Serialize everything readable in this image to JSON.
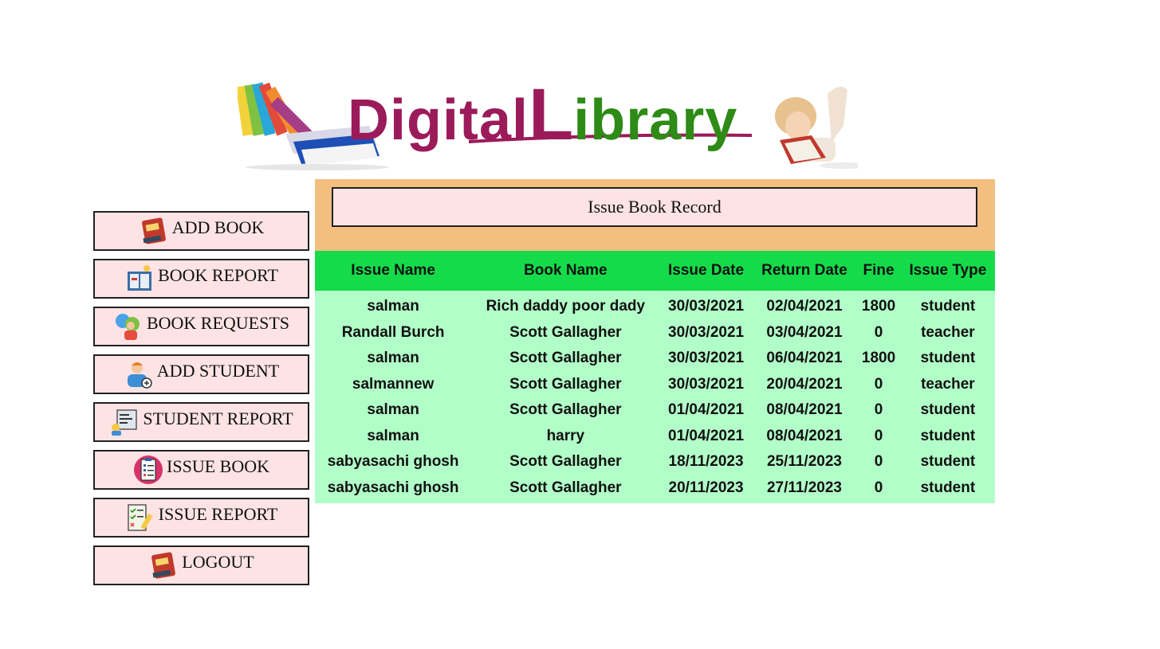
{
  "banner": {
    "logo_part1": "Digital",
    "logo_part2": "L",
    "logo_part3": "ibrary",
    "colors": {
      "primary": "#9b1b5a",
      "secondary": "#2e8b16"
    }
  },
  "sidebar": {
    "items": [
      {
        "label": "ADD BOOK",
        "icon": "book-icon"
      },
      {
        "label": "BOOK REPORT",
        "icon": "book-report-icon"
      },
      {
        "label": "BOOK REQUESTS",
        "icon": "users-icon"
      },
      {
        "label": "ADD STUDENT",
        "icon": "add-user-icon"
      },
      {
        "label": "STUDENT REPORT",
        "icon": "student-report-icon"
      },
      {
        "label": "ISSUE BOOK",
        "icon": "clipboard-icon"
      },
      {
        "label": "ISSUE REPORT",
        "icon": "checklist-icon"
      },
      {
        "label": "LOGOUT",
        "icon": "book-icon"
      }
    ]
  },
  "main": {
    "title": "Issue Book Record",
    "colors": {
      "header_bg": "#15db4b",
      "body_bg": "#b2fec8",
      "title_bg": "#f3bf81",
      "button_bg": "#fde3e4"
    },
    "columns": [
      "Issue Name",
      "Book Name",
      "Issue Date",
      "Return Date",
      "Fine",
      "Issue Type"
    ],
    "rows": [
      [
        "salman",
        "Rich daddy poor dady",
        "30/03/2021",
        "02/04/2021",
        "1800",
        "student"
      ],
      [
        "Randall Burch",
        "Scott Gallagher",
        "30/03/2021",
        "03/04/2021",
        "0",
        "teacher"
      ],
      [
        "salman",
        "Scott Gallagher",
        "30/03/2021",
        "06/04/2021",
        "1800",
        "student"
      ],
      [
        "salmannew",
        "Scott Gallagher",
        "30/03/2021",
        "20/04/2021",
        "0",
        "teacher"
      ],
      [
        "salman",
        "Scott Gallagher",
        "01/04/2021",
        "08/04/2021",
        "0",
        "student"
      ],
      [
        "salman",
        "harry",
        "01/04/2021",
        "08/04/2021",
        "0",
        "student"
      ],
      [
        "sabyasachi ghosh",
        "Scott Gallagher",
        "18/11/2023",
        "25/11/2023",
        "0",
        "student"
      ],
      [
        "sabyasachi ghosh",
        "Scott Gallagher",
        "20/11/2023",
        "27/11/2023",
        "0",
        "student"
      ]
    ]
  }
}
